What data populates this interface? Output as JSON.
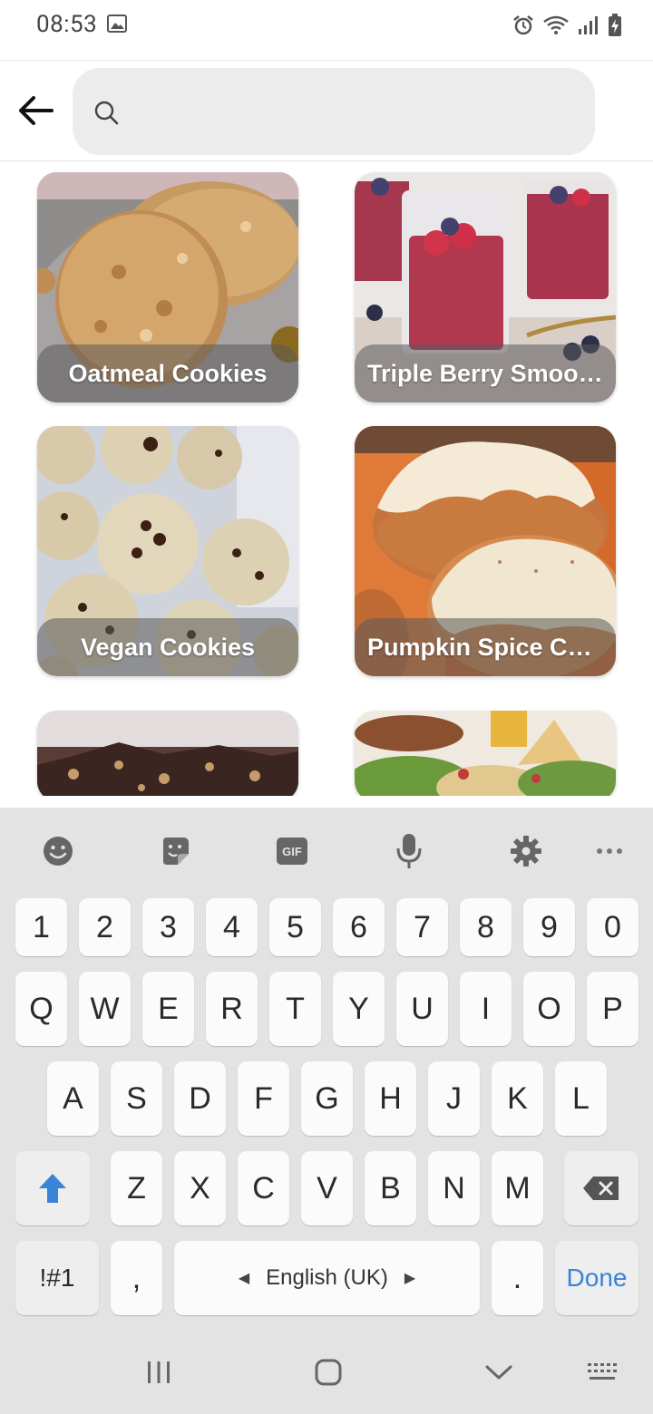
{
  "status_bar": {
    "time": "08:53"
  },
  "search": {
    "value": "",
    "placeholder": ""
  },
  "cards": [
    {
      "title": "Oatmeal Cookies"
    },
    {
      "title": "Triple Berry Smoot…"
    },
    {
      "title": "Vegan Cookies"
    },
    {
      "title": "Pumpkin Spice Co…"
    },
    {
      "title": ""
    },
    {
      "title": ""
    }
  ],
  "keyboard": {
    "toolbar": [
      "emoji-icon",
      "sticker-icon",
      "gif-icon",
      "microphone-icon",
      "gear-icon",
      "more-icon"
    ],
    "gif_label": "GIF",
    "row_numbers": [
      "1",
      "2",
      "3",
      "4",
      "5",
      "6",
      "7",
      "8",
      "9",
      "0"
    ],
    "row_1": [
      "Q",
      "W",
      "E",
      "R",
      "T",
      "Y",
      "U",
      "I",
      "O",
      "P"
    ],
    "row_2": [
      "A",
      "S",
      "D",
      "F",
      "G",
      "H",
      "J",
      "K",
      "L"
    ],
    "row_3": [
      "Z",
      "X",
      "C",
      "V",
      "B",
      "N",
      "M"
    ],
    "symbols_label": "!#1",
    "comma_label": ",",
    "space_label": "English (UK)",
    "period_label": ".",
    "done_label": "Done",
    "accent_color": "#3a84d8"
  },
  "nav_bar": {
    "items": [
      "recents-icon",
      "home-icon",
      "back-chevron-icon",
      "keyboard-icon"
    ]
  }
}
